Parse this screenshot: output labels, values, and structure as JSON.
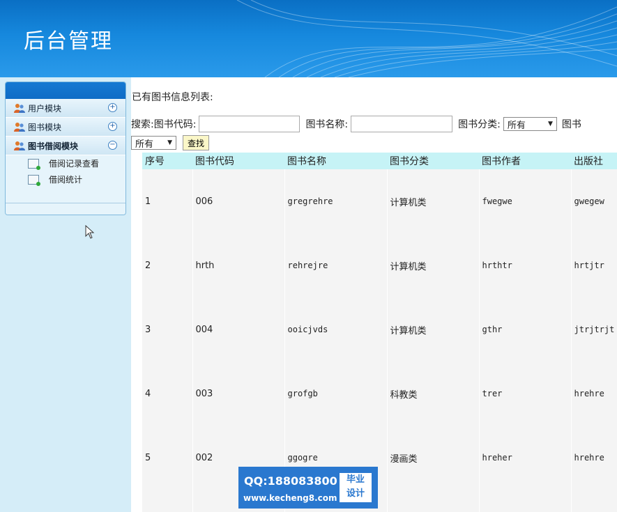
{
  "header": {
    "title": "后台管理"
  },
  "sidebar": {
    "items": [
      {
        "label": "用户模块",
        "toggle": "+"
      },
      {
        "label": "图书模块",
        "toggle": "+"
      },
      {
        "label": "图书借阅模块",
        "toggle": "−",
        "children": [
          "借阅记录查看",
          "借阅统计"
        ]
      }
    ]
  },
  "main": {
    "heading": "已有图书信息列表:",
    "search": {
      "prefix": "搜索:",
      "code_label": "图书代码:",
      "code_value": "",
      "name_label": "图书名称:",
      "name_value": "",
      "category_label": "图书分类:",
      "category_value": "所有",
      "author_label": "图书",
      "second_value": "所有",
      "button": "查找"
    },
    "table": {
      "headers": [
        "序号",
        "图书代码",
        "图书名称",
        "图书分类",
        "图书作者",
        "出版社"
      ],
      "rows": [
        [
          "1",
          "006",
          "gregrehre",
          "计算机类",
          "fwegwe",
          "gwegew"
        ],
        [
          "2",
          "hrth",
          "rehrejre",
          "计算机类",
          "hrthtr",
          "hrtjtr"
        ],
        [
          "3",
          "004",
          "ooicjvds",
          "计算机类",
          "gthr",
          "jtrjtrjt"
        ],
        [
          "4",
          "003",
          "grofgb",
          "科教类",
          "trer",
          "hrehre"
        ],
        [
          "5",
          "002",
          "ggogre",
          "漫画类",
          "hreher",
          "hrehre"
        ]
      ]
    }
  },
  "watermark": {
    "qq": "QQ:188083800",
    "url": "www.kecheng8.com",
    "badge_top": "毕业",
    "badge_bottom": "设计"
  }
}
